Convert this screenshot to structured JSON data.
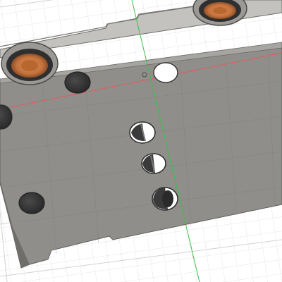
{
  "scene": {
    "description_visible_text": "",
    "colors": {
      "background": "#ffffff",
      "grid_minor": "#e6e6e6",
      "grid_major": "#cfcfcf",
      "plate_face": "#8c8b87",
      "plate_edge": "#a3a29e",
      "plate_wall": "#b8b7b3",
      "axis_x": "#e35b5b",
      "axis_y": "#3cbf4a",
      "hole_dark": "#3a3a3a",
      "hole_white": "#ffffff",
      "speaker_copper": "#c5733e"
    },
    "objects": {
      "plate": "enclosure-bottom-plate",
      "speakers": [
        "speaker-left",
        "speaker-right"
      ],
      "holes": [
        "hole-top-white",
        "hole-left-edge",
        "hole-dark-top",
        "hole-center-1",
        "hole-center-2",
        "hole-center-3",
        "hole-bottom-left"
      ]
    }
  }
}
